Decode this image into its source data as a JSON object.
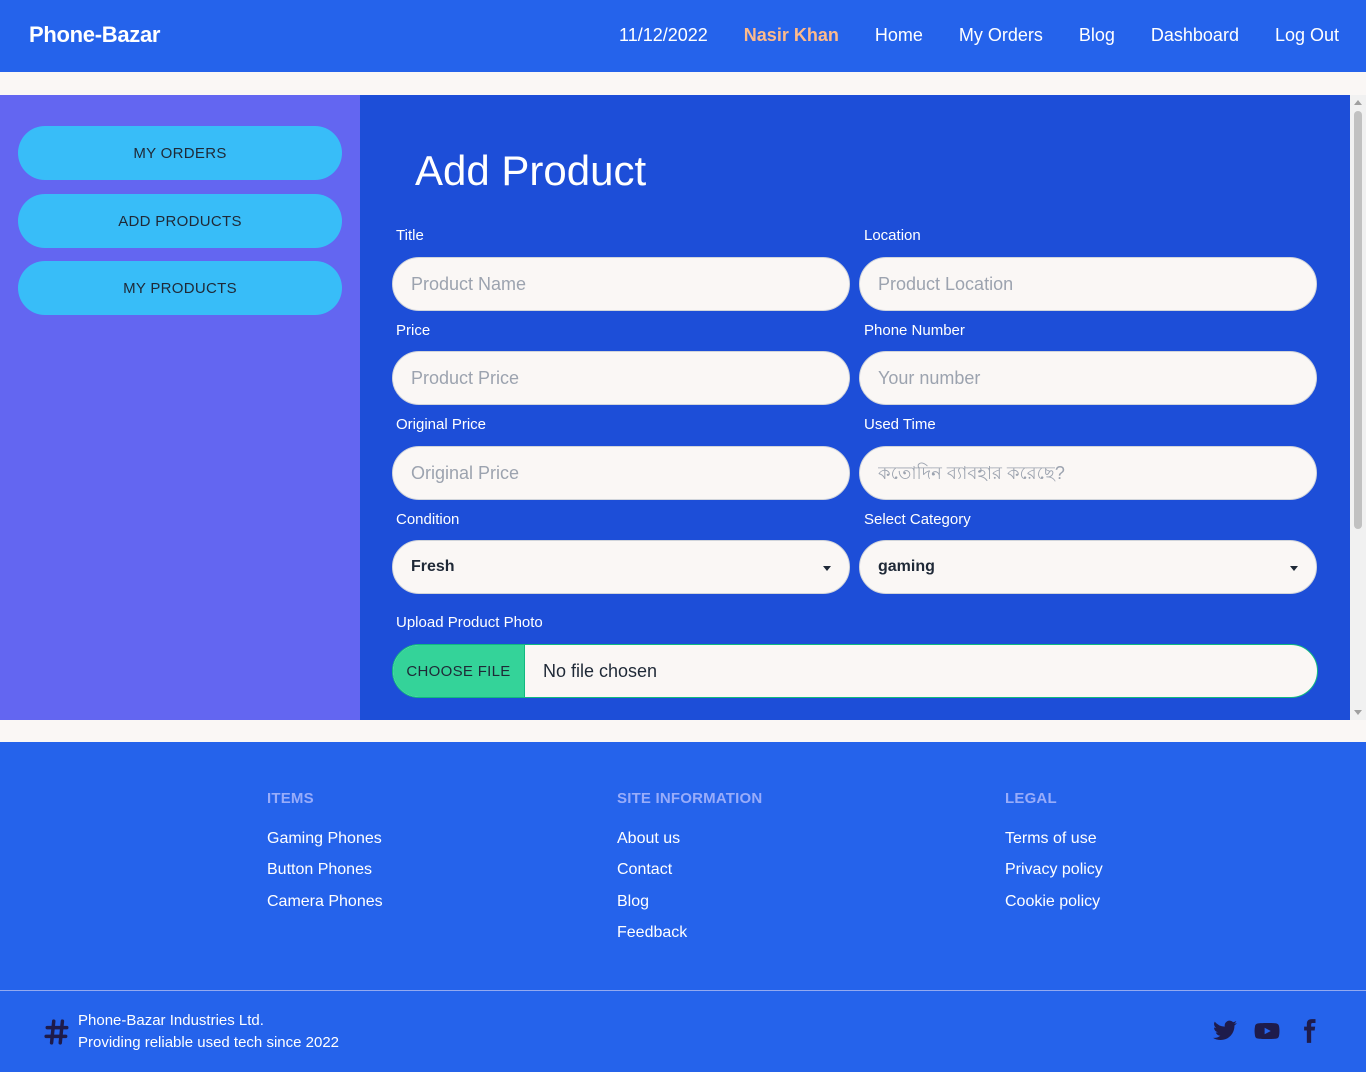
{
  "nav": {
    "brand": "Phone-Bazar",
    "date": "11/12/2022",
    "user": "Nasir Khan",
    "links": [
      "Home",
      "My Orders",
      "Blog",
      "Dashboard",
      "Log Out"
    ]
  },
  "sidebar": {
    "items": [
      "MY ORDERS",
      "ADD PRODUCTS",
      "MY PRODUCTS"
    ]
  },
  "form": {
    "title": "Add Product",
    "title_label": "Title",
    "title_placeholder": "Product Name",
    "location_label": "Location",
    "location_placeholder": "Product Location",
    "price_label": "Price",
    "price_placeholder": "Product Price",
    "phone_label": "Phone Number",
    "phone_placeholder": "Your number",
    "original_label": "Original Price",
    "original_placeholder": "Original Price",
    "used_label": "Used Time",
    "used_placeholder": "কতোদিন ব্যাবহার করেছে?",
    "condition_label": "Condition",
    "condition_value": "Fresh",
    "category_label": "Select Category",
    "category_value": "gaming",
    "upload_label": "Upload Product Photo",
    "choose_file": "CHOOSE FILE",
    "no_file": "No file chosen"
  },
  "footer": {
    "items_title": "ITEMS",
    "items": [
      "Gaming Phones",
      "Button Phones",
      "Camera Phones"
    ],
    "site_title": "SITE INFORMATION",
    "site": [
      "About us",
      "Contact",
      "Blog",
      "Feedback"
    ],
    "legal_title": "LEGAL",
    "legal": [
      "Terms of use",
      "Privacy policy",
      "Cookie policy"
    ],
    "copyright_line1": "Phone-Bazar Industries Ltd.",
    "copyright_line2": "Providing reliable used tech since 2022",
    "social_icons": [
      "twitter-icon",
      "youtube-icon",
      "facebook-icon"
    ]
  }
}
